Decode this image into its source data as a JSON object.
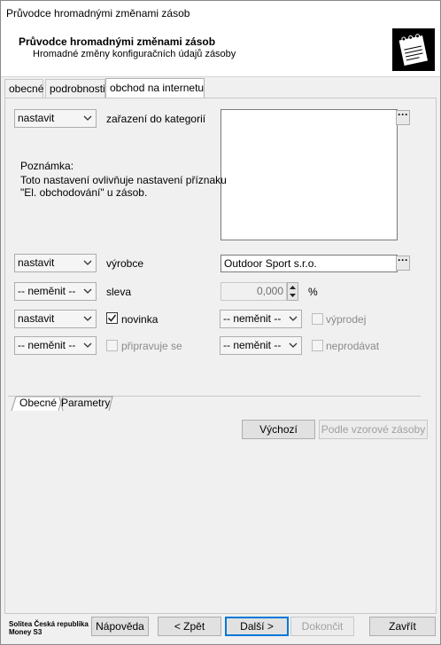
{
  "window": {
    "title": "Průvodce hromadnými změnami zásob"
  },
  "header": {
    "title": "Průvodce hromadnými změnami zásob",
    "subtitle": "Hromadné změny konfiguračních údajů zásoby"
  },
  "tabs": [
    {
      "label": "obecné",
      "active": false
    },
    {
      "label": "podrobnosti",
      "active": false
    },
    {
      "label": "obchod na internetu",
      "active": true
    }
  ],
  "form": {
    "category": {
      "mode": "nastavit",
      "label": "zařazení do kategorií",
      "dots": "···"
    },
    "note": {
      "heading": "Poznámka:",
      "line1": "Toto nastavení ovlivňuje nastavení příznaku",
      "line2": "\"El. obchodování\" u zásob."
    },
    "manufacturer": {
      "mode": "nastavit",
      "label": "výrobce",
      "value": "Outdoor Sport s.r.o.",
      "dots": "···"
    },
    "discount": {
      "mode": "-- neměnit --",
      "label": "sleva",
      "value": "0,000",
      "unit": "%"
    },
    "novinka": {
      "mode": "nastavit",
      "label": "novinka",
      "checked": true
    },
    "vyprodej": {
      "mode": "-- neměnit --",
      "label": "výprodej",
      "checked": false
    },
    "pripravuje": {
      "mode": "-- neměnit --",
      "label": "připravuje se",
      "checked": false
    },
    "neprodavat": {
      "mode": "-- neměnit --",
      "label": "neprodávat",
      "checked": false
    }
  },
  "subtabs": [
    {
      "label": "Obecné",
      "active": true
    },
    {
      "label": "Parametry",
      "active": false
    }
  ],
  "subpanel_buttons": {
    "default": "Výchozí",
    "from_template": "Podle vzorové zásoby"
  },
  "footer": {
    "brand_line1": "Solitea Česká republika",
    "brand_line2": "Money S3",
    "help": "Nápověda",
    "back": "< Zpět",
    "next": "Další >",
    "finish": "Dokončit",
    "close": "Zavřít"
  }
}
